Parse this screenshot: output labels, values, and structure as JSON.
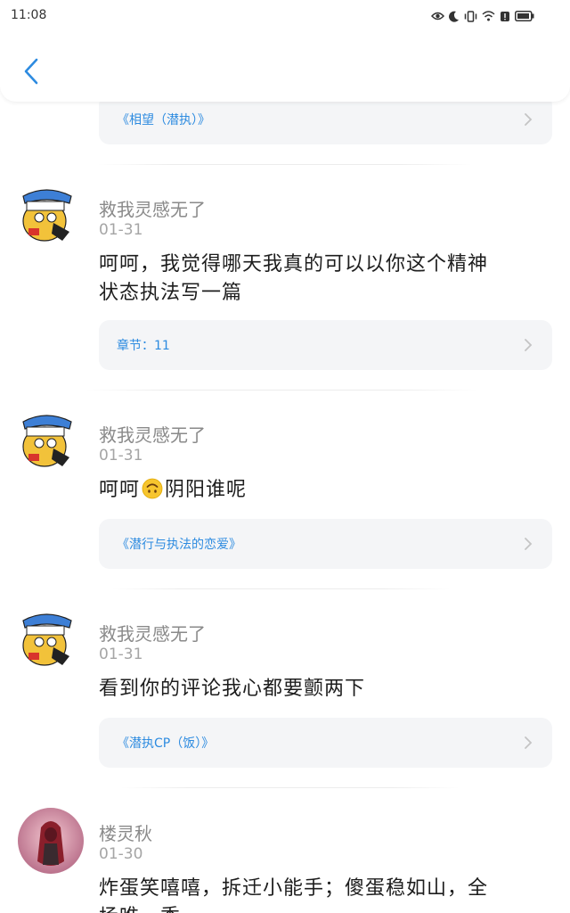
{
  "status_bar": {
    "time": "11:08",
    "icons": [
      "eye-icon",
      "moon-icon",
      "vibrate-icon",
      "wifi-icon",
      "alert-icon",
      "battery-icon"
    ]
  },
  "header": {
    "back_icon": "chevron-left-icon"
  },
  "colors": {
    "accent_blue": "#2d8be0",
    "card_bg": "#f4f5f7",
    "muted_text": "#8a8a8a"
  },
  "comments": [
    {
      "ref_label": "《相望（潜执）》"
    },
    {
      "username": "救我灵感无了",
      "date": "01-31",
      "content": "呵呵，我觉得哪天我真的可以以你这个精神状态执法写一篇",
      "content_line1": "呵呵，我觉得哪天我真的可以以你这个精神",
      "content_line2": "状态执法写一篇",
      "ref_label": "章节：11"
    },
    {
      "username": "救我灵感无了",
      "date": "01-31",
      "content_before_emoji": "呵呵",
      "emoji": "upside-down-face-emoji",
      "content_after_emoji": "阴阳谁呢",
      "ref_label": "《潜行与执法的恋爱》"
    },
    {
      "username": "救我灵感无了",
      "date": "01-31",
      "content": "看到你的评论我心都要颤两下",
      "ref_label": "《潜执CP（饭）》"
    },
    {
      "username": "楼灵秋",
      "date": "01-30",
      "content_line1": "炸蛋笑嘻嘻，拆迁小能手；傻蛋稳如山，全",
      "content_line2": "场唯一秀"
    }
  ]
}
